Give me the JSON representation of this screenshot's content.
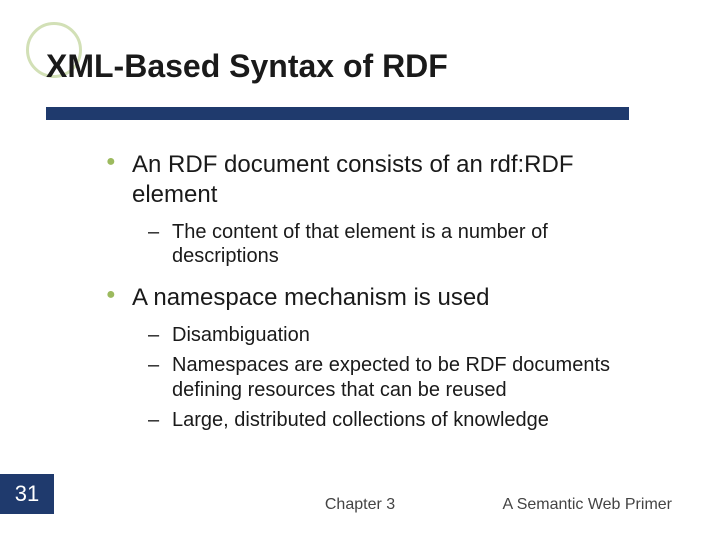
{
  "title": "XML-Based Syntax of RDF",
  "bullets": {
    "b1": {
      "text_pre": "An RDF document consists of an ",
      "text_code": "rdf:RDF",
      "text_post": " element",
      "sub": {
        "s1": "The content of that element is a number of descriptions"
      }
    },
    "b2": {
      "text": "A namespace mechanism is used",
      "sub": {
        "s1": "Disambiguation",
        "s2": "Namespaces are expected to be RDF documents defining resources that can be reused",
        "s3": "Large, distributed collections of knowledge"
      }
    }
  },
  "footer": {
    "page": "31",
    "center": "Chapter 3",
    "right": "A Semantic Web Primer"
  },
  "chart_data": null
}
